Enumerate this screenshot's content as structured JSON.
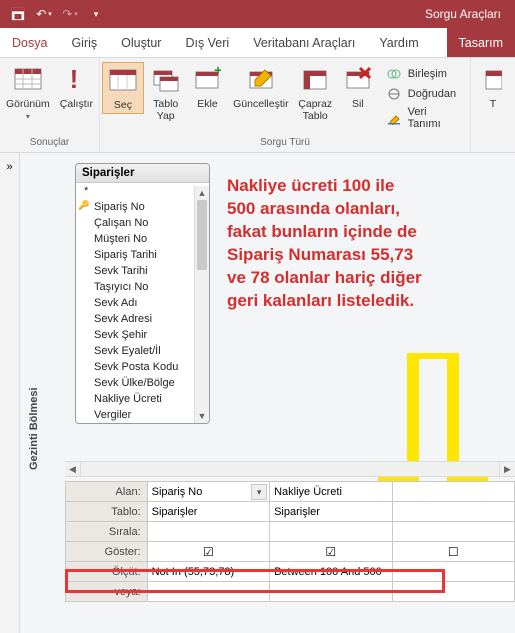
{
  "titlebar": {
    "context_tab": "Sorgu Araçları"
  },
  "tabs": {
    "file": "Dosya",
    "home": "Giriş",
    "create": "Oluştur",
    "external": "Dış Veri",
    "dbtools": "Veritabanı Araçları",
    "help": "Yardım",
    "design": "Tasarım"
  },
  "ribbon": {
    "view": "Görünüm",
    "run": "Çalıştır",
    "select": "Seç",
    "maketable": "Tablo\nYap",
    "append": "Ekle",
    "update": "Güncelleştir",
    "crosstab": "Çapraz\nTablo",
    "delete": "Sil",
    "union": "Birleşim",
    "passthrough": "Doğrudan",
    "datadef": "Veri Tanımı",
    "group_results": "Sonuçlar",
    "group_querytype": "Sorgu Türü"
  },
  "nav_pane": "Gezinti Bölmesi",
  "table_card": {
    "title": "Siparişler",
    "fields": [
      "*",
      "Sipariş No",
      "Çalışan No",
      "Müşteri No",
      "Sipariş Tarihi",
      "Sevk Tarihi",
      "Taşıyıcı No",
      "Sevk Adı",
      "Sevk Adresi",
      "Sevk Şehir",
      "Sevk Eyalet/İl",
      "Sevk Posta Kodu",
      "Sevk Ülke/Bölge",
      "Nakliye Ücreti",
      "Vergiler"
    ]
  },
  "annotation_lines": [
    "Nakliye ücreti 100 ile",
    "500 arasında olanları,",
    "fakat bunların içinde de",
    "Sipariş Numarası 55,73",
    "ve 78 olanlar hariç diğer",
    "geri kalanları listeledik."
  ],
  "grid": {
    "row_labels": {
      "field": "Alan:",
      "table": "Tablo:",
      "sort": "Sırala:",
      "show": "Göster:",
      "criteria": "Ölçüt:",
      "or": "veya:"
    },
    "columns": [
      {
        "field": "Sipariş No",
        "table": "Siparişler",
        "sort": "",
        "show": true,
        "criteria": "Not In (55;73;78)",
        "or": ""
      },
      {
        "field": "Nakliye Ücreti",
        "table": "Siparişler",
        "sort": "",
        "show": true,
        "criteria": "Between 100 And 500",
        "or": ""
      },
      {
        "field": "",
        "table": "",
        "sort": "",
        "show": false,
        "criteria": "",
        "or": ""
      }
    ]
  }
}
